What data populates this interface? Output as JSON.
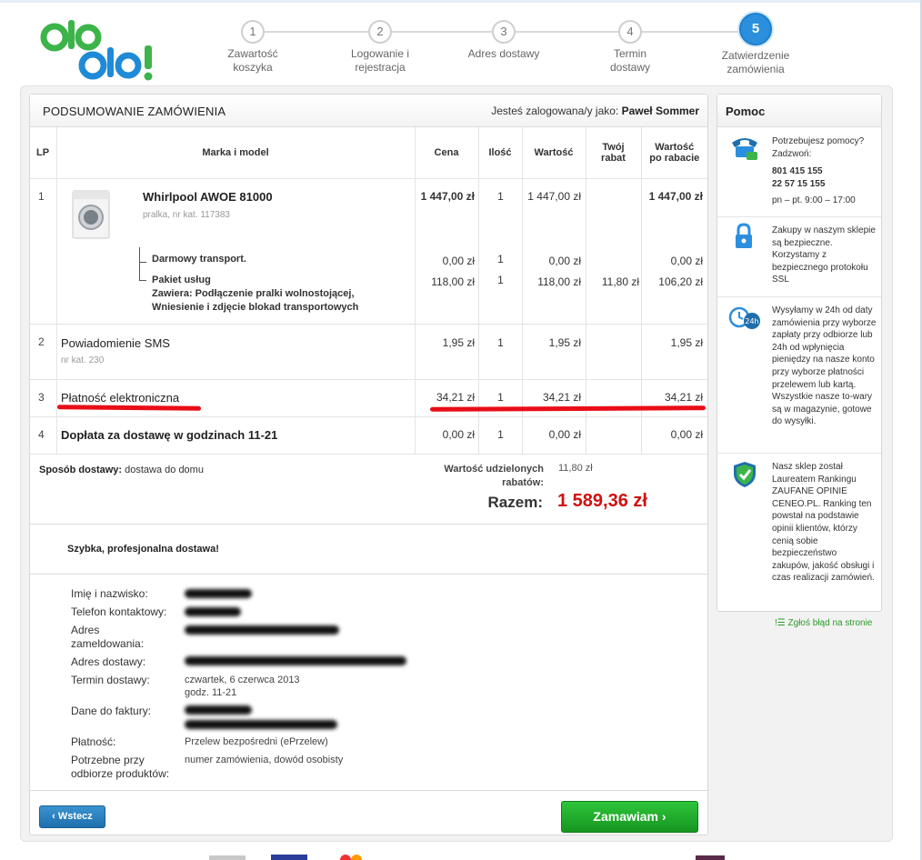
{
  "steps": [
    {
      "num": "1",
      "label": "Zawartość koszyka"
    },
    {
      "num": "2",
      "label": "Logowanie i rejestracja"
    },
    {
      "num": "3",
      "label": "Adres dostawy"
    },
    {
      "num": "4",
      "label": "Termin dostawy"
    },
    {
      "num": "5",
      "label": "Zatwierdzenie zamówienia"
    }
  ],
  "summary": {
    "title": "PODSUMOWANIE ZAMÓWIENIA",
    "logged_prefix": "Jesteś zalogowana/y jako:",
    "logged_user": "Paweł Sommer"
  },
  "columns": {
    "lp": "LP",
    "brand": "Marka i model",
    "price": "Cena",
    "qty": "Ilość",
    "value": "Wartość",
    "discount": "Twój rabat",
    "after": "Wartość po rabacie"
  },
  "rows": [
    {
      "lp": "1",
      "name": "Whirlpool AWOE 81000",
      "sub": "pralka, nr kat. 117383",
      "price": "1 447,00 zł",
      "qty": "1",
      "value": "1 447,00 zł",
      "discount": "",
      "after": "1 447,00 zł",
      "addons": [
        {
          "name": "Darmowy transport.",
          "price": "0,00 zł",
          "qty": "1",
          "value": "0,00 zł",
          "discount": "",
          "after": "0,00 zł"
        },
        {
          "name": "Pakiet usług",
          "detail": "Zawiera: Podłączenie pralki wolnostojącej, Wniesienie i zdjęcie blokad transportowych",
          "price": "118,00 zł",
          "qty": "1",
          "value": "118,00 zł",
          "discount": "11,80 zł",
          "after": "106,20 zł"
        }
      ]
    },
    {
      "lp": "2",
      "name": "Powiadomienie SMS",
      "sub": "nr kat. 230",
      "price": "1,95 zł",
      "qty": "1",
      "value": "1,95 zł",
      "discount": "",
      "after": "1,95 zł"
    },
    {
      "lp": "3",
      "name": "Płatność elektroniczna",
      "sub": "",
      "price": "34,21 zł",
      "qty": "1",
      "value": "34,21 zł",
      "discount": "",
      "after": "34,21 zł"
    },
    {
      "lp": "4",
      "name": "Dopłata za dostawę w godzinach 11-21",
      "sub": "",
      "price": "0,00 zł",
      "qty": "1",
      "value": "0,00 zł",
      "discount": "",
      "after": "0,00 zł"
    }
  ],
  "delivery": {
    "label": "Sposób dostawy:",
    "value": "dostawa do domu"
  },
  "discount_total": {
    "label": "Wartość udzielonych rabatów:",
    "value": "11,80 zł"
  },
  "total": {
    "label": "Razem:",
    "value": "1 589,36 zł"
  },
  "promo": "Szybka, profesjonalna dostawa!",
  "customer": {
    "name_label": "Imię i nazwisko:",
    "phone_label": "Telefon kontaktowy:",
    "address_label": "Adres zameldowania:",
    "delivery_address_label": "Adres dostawy:",
    "term_label": "Termin dostawy:",
    "term_value_1": "czwartek, 6 czerwca 2013",
    "term_value_2": "godz. 11-21",
    "invoice_label": "Dane do faktury:",
    "payment_label": "Płatność:",
    "payment_value": "Przelew bezpośredni (ePrzelew)",
    "required_label": "Potrzebne przy odbiorze produktów:",
    "required_value": "numer zamówienia, dowód osobisty"
  },
  "buttons": {
    "back": "Wstecz",
    "order": "Zamawiam"
  },
  "help": {
    "title": "Pomoc",
    "phone_intro": "Potrzebujesz pomocy? Zadzwoń:",
    "phone_1": "801 415 155",
    "phone_2": "22 57 15 155",
    "hours": "pn – pt. 9:00 – 17:00",
    "secure": "Zakupy w naszym sklepie są bezpieczne. Korzystamy z bezpiecznego protokołu SSL",
    "shipping": "Wysyłamy w 24h od daty zamówienia przy wyborze zapłaty przy odbiorze lub 24h od wpłynięcia pieniędzy na nasze konto przy wyborze płatności przelewem lub kartą. Wszystkie nasze to-wary są w magazynie, gotowe do wysyłki.",
    "award": "Nasz sklep został Laureatem Rankingu ZAUFANE OPINIE CENEO.PL. Ranking ten powstał na podstawie opinii klientów, którzy cenią sobie bezpieczeństwo zakupów, jakość obsługi i czas realizacji zamówień."
  },
  "report_error": "Zgłoś błąd na stronie",
  "logo": {
    "line1": "ole",
    "line2": "ole!"
  },
  "colors": {
    "brand_green": "#3cb44a",
    "brand_blue": "#1f8ad6",
    "accent_red": "#cf1010",
    "order_green": "#16961f"
  }
}
